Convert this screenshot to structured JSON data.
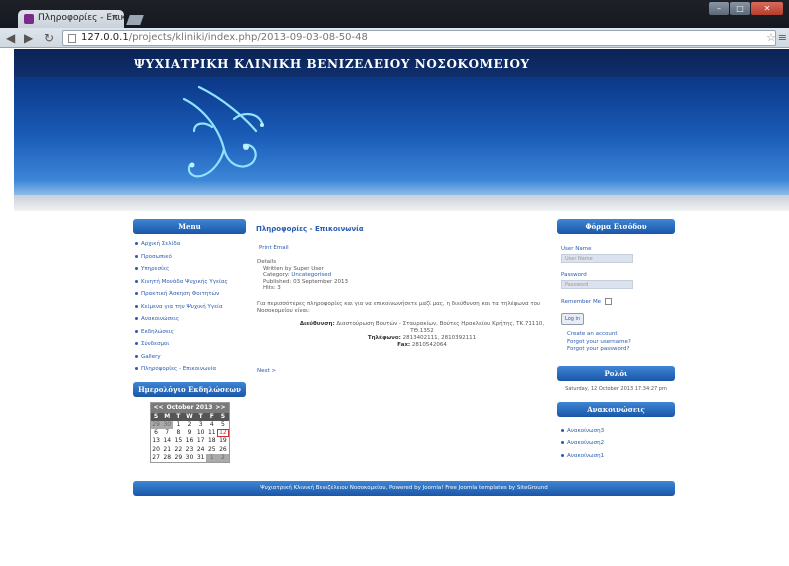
{
  "browser": {
    "tab_title": "Πληροφορίες - Επικοινωνία",
    "url_host": "127.0.0.1",
    "url_path": "/projects/kliniki/index.php/2013-09-03-08-50-48"
  },
  "site": {
    "title": "ΨΥΧΙΑΤΡΙΚΗ ΚΛΙΝΙΚΗ ΒΕΝΙΖΕΛΕΙΟΥ ΝΟΣΟΚΟΜΕΙΟΥ"
  },
  "menu": {
    "heading": "Menu",
    "items": [
      "Αρχική Σελίδα",
      "Προσωπικό",
      "Υπηρεσίες",
      "Κινητή Μονάδα Ψυχικής Υγείας",
      "Πρακτική Άσκηση Φοιτητών",
      "Κείμενα για την Ψυχική Υγεία",
      "Ανακοινώσεις",
      "Εκδηλώσεις",
      "Σύνδεσμοι",
      "Gallery",
      "Πληροφορίες - Επικοινωνία"
    ]
  },
  "calendar": {
    "heading": "Ημερολόγιο Εκδηλώσεων",
    "prev": "<<",
    "next": ">>",
    "month": "October 2013",
    "weekdays": [
      "S",
      "M",
      "T",
      "W",
      "T",
      "F",
      "S"
    ],
    "cells": [
      {
        "d": "29",
        "out": true
      },
      {
        "d": "30",
        "out": true
      },
      {
        "d": "1"
      },
      {
        "d": "2"
      },
      {
        "d": "3"
      },
      {
        "d": "4"
      },
      {
        "d": "5"
      },
      {
        "d": "6"
      },
      {
        "d": "7"
      },
      {
        "d": "8"
      },
      {
        "d": "9"
      },
      {
        "d": "10"
      },
      {
        "d": "11"
      },
      {
        "d": "12",
        "today": true
      },
      {
        "d": "13"
      },
      {
        "d": "14"
      },
      {
        "d": "15"
      },
      {
        "d": "16"
      },
      {
        "d": "17"
      },
      {
        "d": "18"
      },
      {
        "d": "19"
      },
      {
        "d": "20"
      },
      {
        "d": "21"
      },
      {
        "d": "22"
      },
      {
        "d": "23"
      },
      {
        "d": "24"
      },
      {
        "d": "25"
      },
      {
        "d": "26"
      },
      {
        "d": "27"
      },
      {
        "d": "28"
      },
      {
        "d": "29"
      },
      {
        "d": "30"
      },
      {
        "d": "31"
      },
      {
        "d": "1",
        "out": true
      },
      {
        "d": "2",
        "out": true
      }
    ]
  },
  "article": {
    "title": "Πληροφορίες - Επικοινωνία",
    "print_email": "Print Email",
    "details_label": "Details",
    "written_by": "Written by Super User",
    "category_label": "Category:",
    "category_value": "Uncategorised",
    "published": "Published: 03 September 2013",
    "hits": "Hits: 3",
    "intro": "Για περισσότερες πληροφορίες και για να επικοινωνήσετε μαζί μας, η διεύθυνση και τα τηλέφωνα του Νοσοκομείου είναι:",
    "address_label": "Διεύθυνση:",
    "address_value": "Διαστούρωση Βουτών - Σταυρακίων, Βούτες Ηρακλείου Κρήτης, ΤΚ.71110, ΤΘ.1352",
    "phone_label": "Τηλέφωνο:",
    "phone_value": "2813402111, 2810392111",
    "fax_label": "Fax:",
    "fax_value": "2810542064",
    "next": "Next >"
  },
  "login": {
    "heading": "Φόρμα Εισόδου",
    "username_label": "User Name",
    "username_placeholder": "User Name",
    "password_label": "Password",
    "password_placeholder": "Password",
    "remember_label": "Remember Me",
    "login_button": "Log in",
    "links": [
      "Create an account",
      "Forgot your username?",
      "Forgot your password?"
    ]
  },
  "clock": {
    "heading": "Ρολόι",
    "text": "Saturday, 12 October 2013 17:34:27 pm"
  },
  "announcements": {
    "heading": "Ανακοινώσεις",
    "items": [
      "Ανακοίνωση3",
      "Ανακοίνωση2",
      "Ανακοίνωση1"
    ]
  },
  "footer": {
    "text": "Ψυχιατρική Κλινική Βενιζέλειου Νοσοκομείου, Powered by Joomla! Free Joomla templates by SiteGround"
  }
}
